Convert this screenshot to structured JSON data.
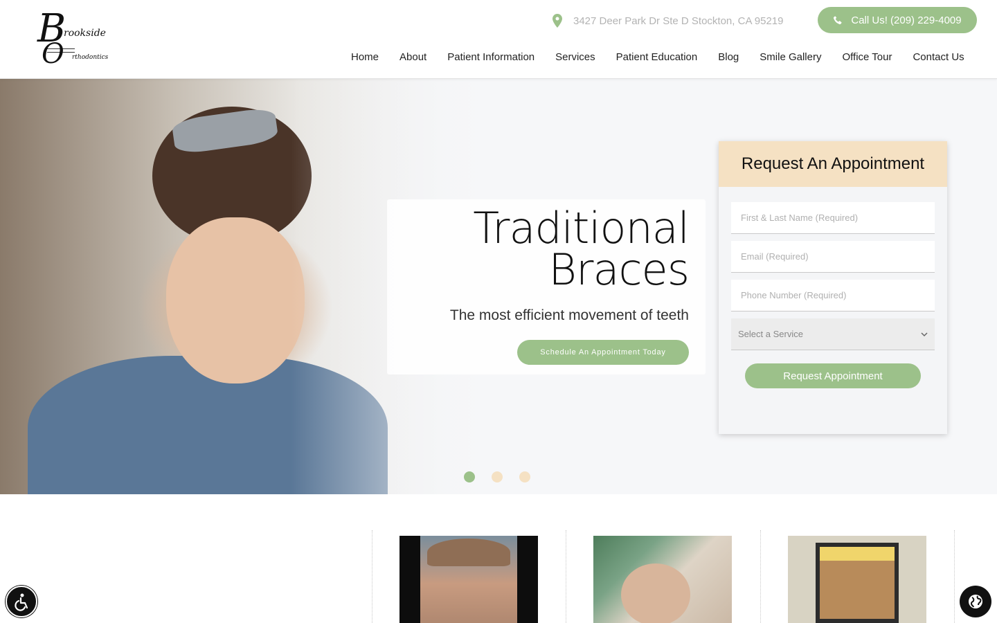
{
  "brand": {
    "logo_b": "B",
    "logo_o": "O",
    "logo_top": "rookside",
    "logo_bottom": "rthodontics"
  },
  "header": {
    "address": "3427 Deer Park Dr Ste D Stockton, CA 95219",
    "call_label": "Call Us! (209) 229-4009",
    "accent_color": "#9cc18a"
  },
  "nav": {
    "items": [
      {
        "label": "Home"
      },
      {
        "label": "About"
      },
      {
        "label": "Patient Information"
      },
      {
        "label": "Services"
      },
      {
        "label": "Patient Education"
      },
      {
        "label": "Blog"
      },
      {
        "label": "Smile Gallery"
      },
      {
        "label": "Office Tour"
      },
      {
        "label": "Contact Us"
      }
    ]
  },
  "hero": {
    "title_line1": "Traditional",
    "title_line2": "Braces",
    "subtitle": "The most efficient movement of teeth",
    "cta_label": "Schedule An Appointment Today",
    "dots": [
      {
        "color": "#9cc18a",
        "active": true
      },
      {
        "color": "#f5e1c3",
        "active": false
      },
      {
        "color": "#f5e1c3",
        "active": false
      }
    ]
  },
  "appointment_form": {
    "heading": "Request An Appointment",
    "heading_bg": "#f5e1c3",
    "name_placeholder": "First & Last Name (Required)",
    "email_placeholder": "Email (Required)",
    "phone_placeholder": "Phone Number (Required)",
    "service_select": "Select a Service",
    "submit_label": "Request Appointment"
  },
  "icons": {
    "address": "map-pin-icon",
    "call": "phone-icon",
    "select": "chevron-down-icon",
    "accessibility": "accessibility-icon",
    "language": "globe-icon"
  }
}
